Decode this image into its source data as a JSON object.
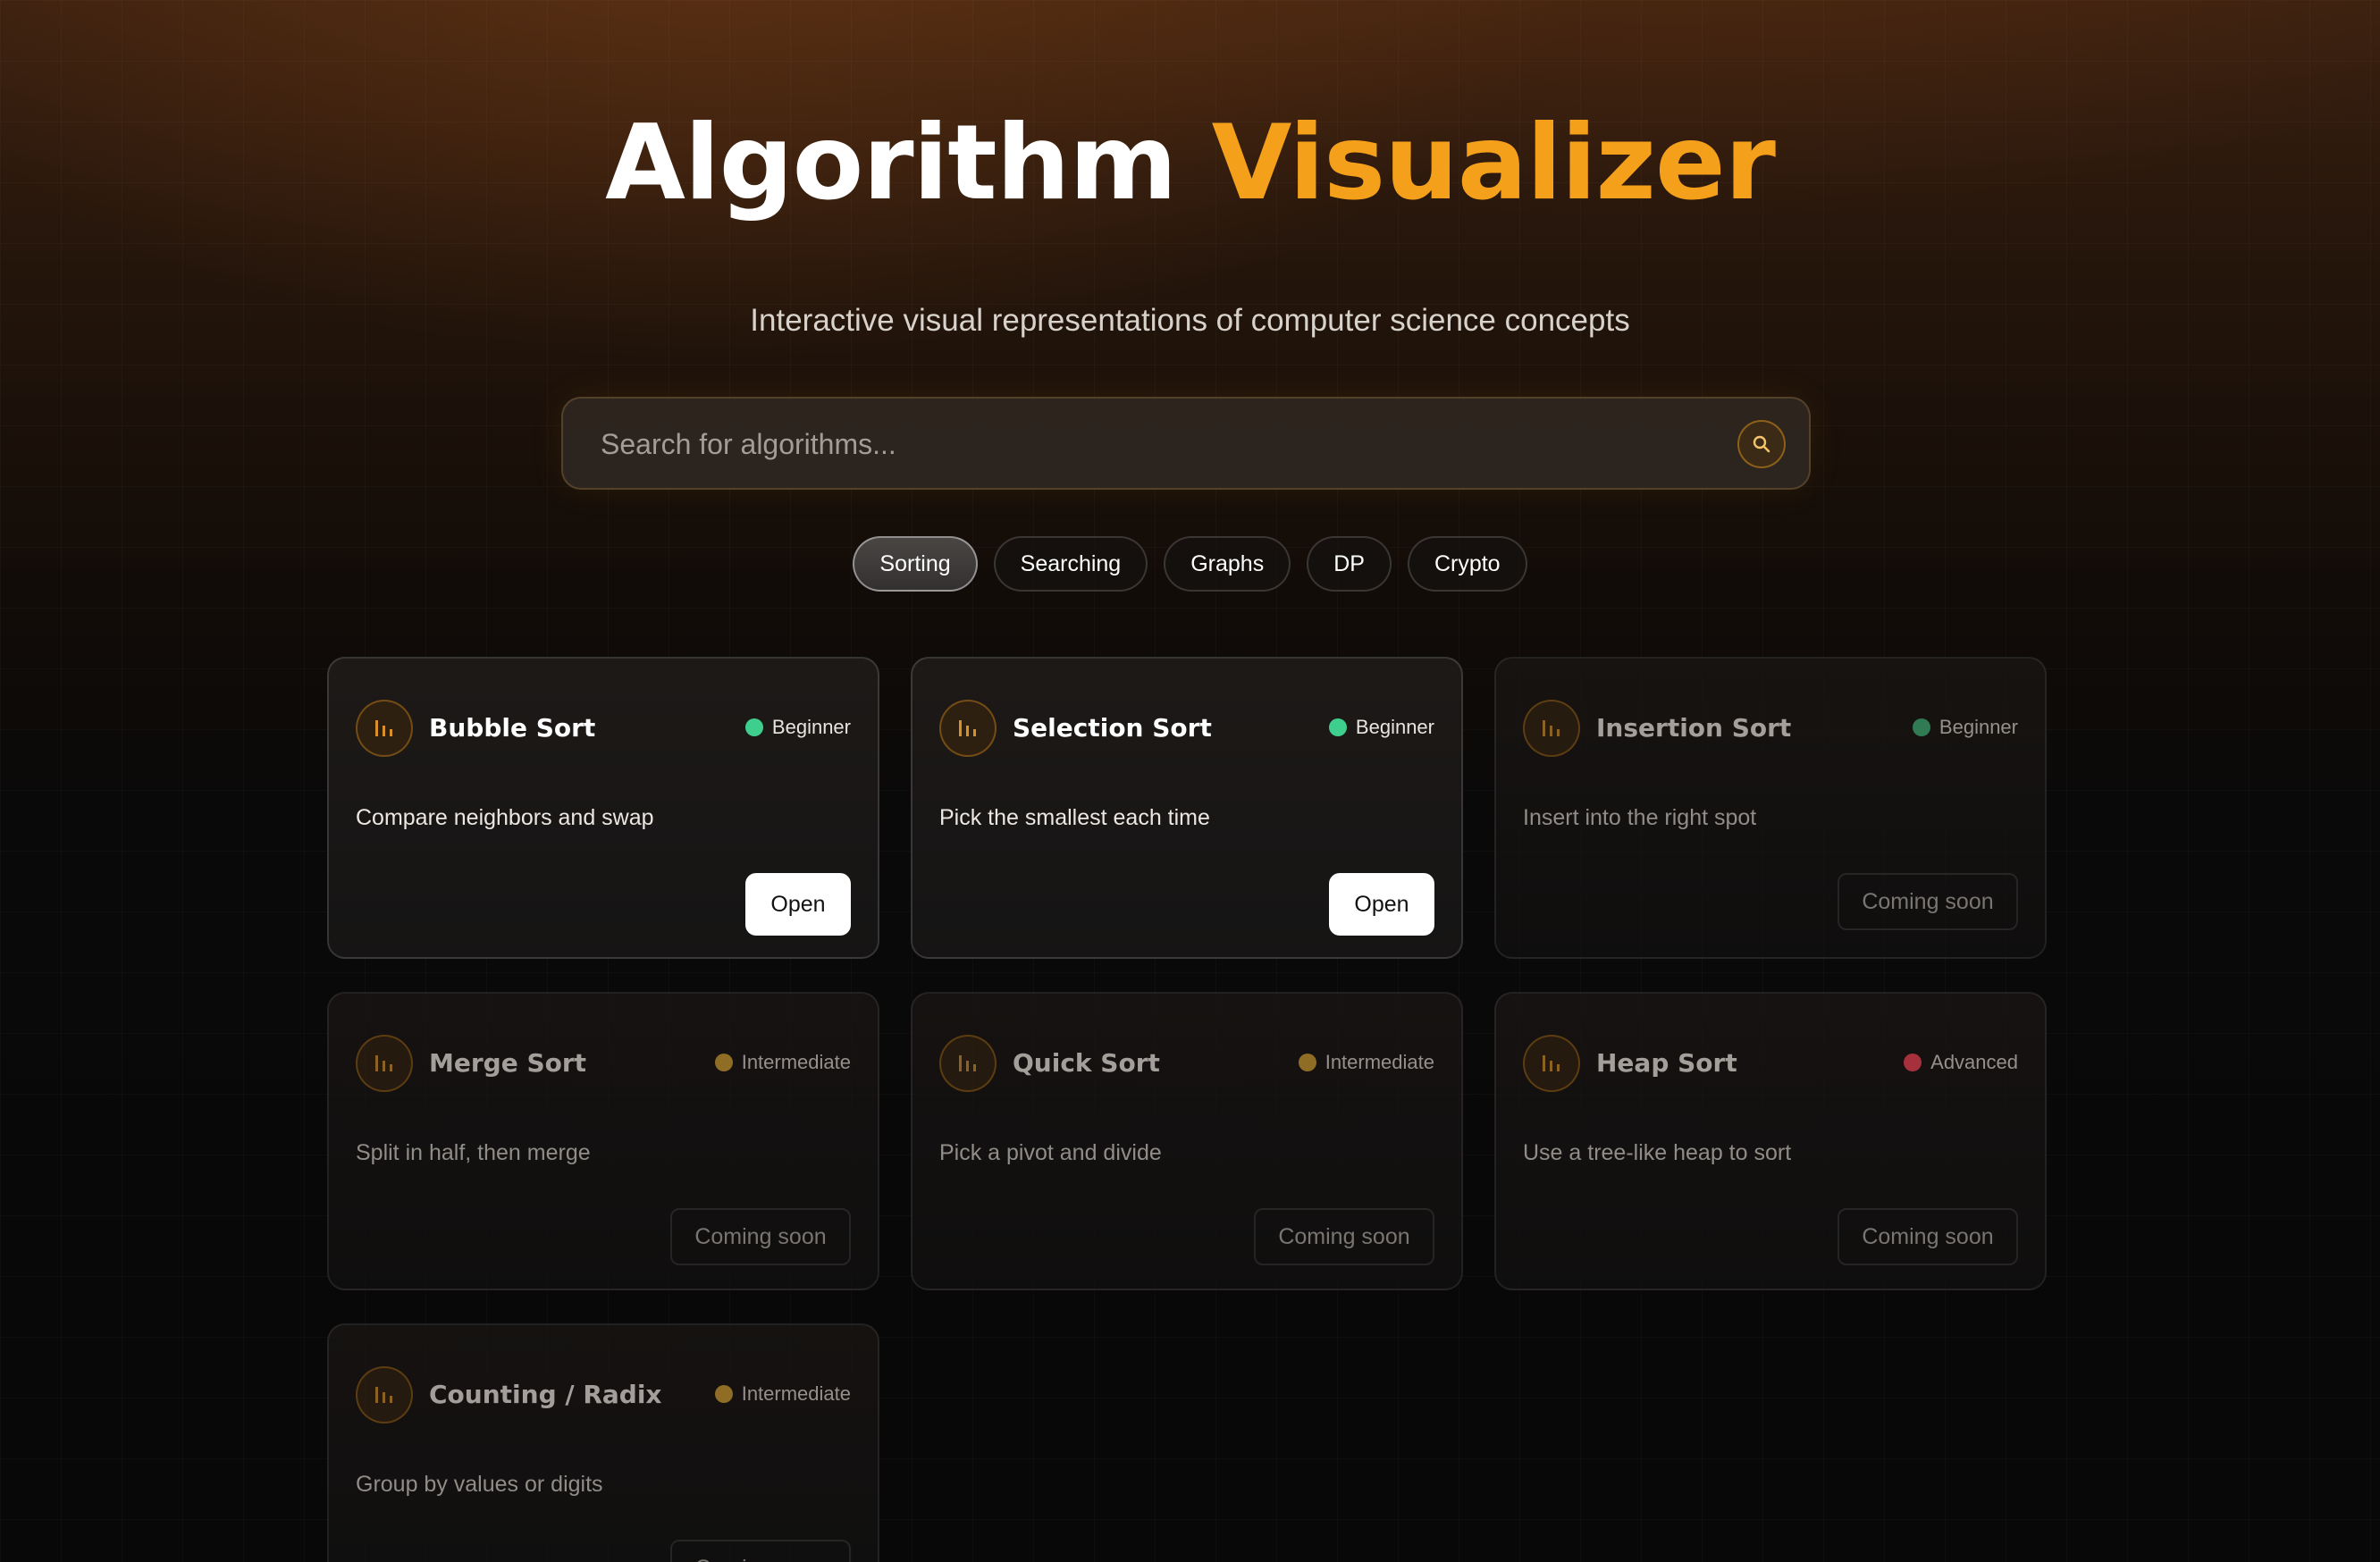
{
  "header": {
    "title_part1": "Algorithm",
    "title_part2": "Visualizer",
    "subtitle": "Interactive visual representations of computer science concepts"
  },
  "search": {
    "placeholder": "Search for algorithms...",
    "value": "",
    "button_icon": "search-icon"
  },
  "tabs": [
    {
      "label": "Sorting",
      "active": true
    },
    {
      "label": "Searching",
      "active": false
    },
    {
      "label": "Graphs",
      "active": false
    },
    {
      "label": "DP",
      "active": false
    },
    {
      "label": "Crypto",
      "active": false
    }
  ],
  "colors": {
    "accent": "#f5a01a",
    "beginner": "#3ecf8e",
    "intermediate": "#b58a2e",
    "advanced": "#d23c4b"
  },
  "cards": [
    {
      "name": "Bubble Sort",
      "level": "Beginner",
      "description": "Compare neighbors and swap",
      "action": "Open",
      "enabled": true,
      "icon": "bar-chart-icon"
    },
    {
      "name": "Selection Sort",
      "level": "Beginner",
      "description": "Pick the smallest each time",
      "action": "Open",
      "enabled": true,
      "icon": "bar-chart-icon"
    },
    {
      "name": "Insertion Sort",
      "level": "Beginner",
      "description": "Insert into the right spot",
      "action": "Coming soon",
      "enabled": false,
      "icon": "bar-chart-icon"
    },
    {
      "name": "Merge Sort",
      "level": "Intermediate",
      "description": "Split in half, then merge",
      "action": "Coming soon",
      "enabled": false,
      "icon": "bar-chart-icon"
    },
    {
      "name": "Quick Sort",
      "level": "Intermediate",
      "description": "Pick a pivot and divide",
      "action": "Coming soon",
      "enabled": false,
      "icon": "bar-chart-icon"
    },
    {
      "name": "Heap Sort",
      "level": "Advanced",
      "description": "Use a tree-like heap to sort",
      "action": "Coming soon",
      "enabled": false,
      "icon": "bar-chart-icon"
    },
    {
      "name": "Counting / Radix",
      "level": "Intermediate",
      "description": "Group by values or digits",
      "action": "Coming soon",
      "enabled": false,
      "icon": "bar-chart-icon"
    }
  ]
}
